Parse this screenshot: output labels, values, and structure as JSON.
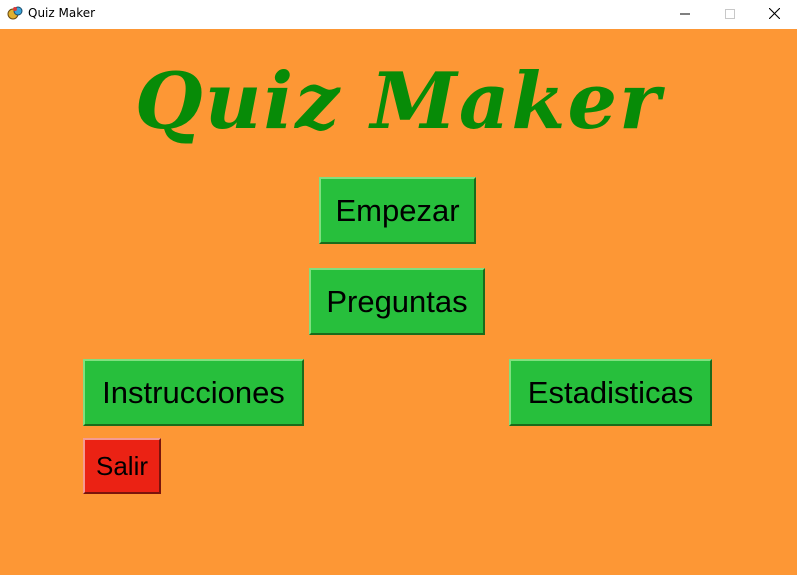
{
  "window": {
    "title": "Quiz Maker",
    "icon": "quiz-app-icon",
    "controls": [
      "minimize",
      "maximize",
      "close"
    ]
  },
  "app": {
    "heading": "Quiz Maker",
    "background_color": "#fd9735",
    "heading_color": "#078b07"
  },
  "menu": {
    "empezar_label": "Empezar",
    "preguntas_label": "Preguntas",
    "instrucciones_label": "Instrucciones",
    "estadisticas_label": "Estadisticas",
    "salir_label": "Salir"
  },
  "colors": {
    "button_green": "#27bf3c",
    "button_red": "#eb2214"
  }
}
